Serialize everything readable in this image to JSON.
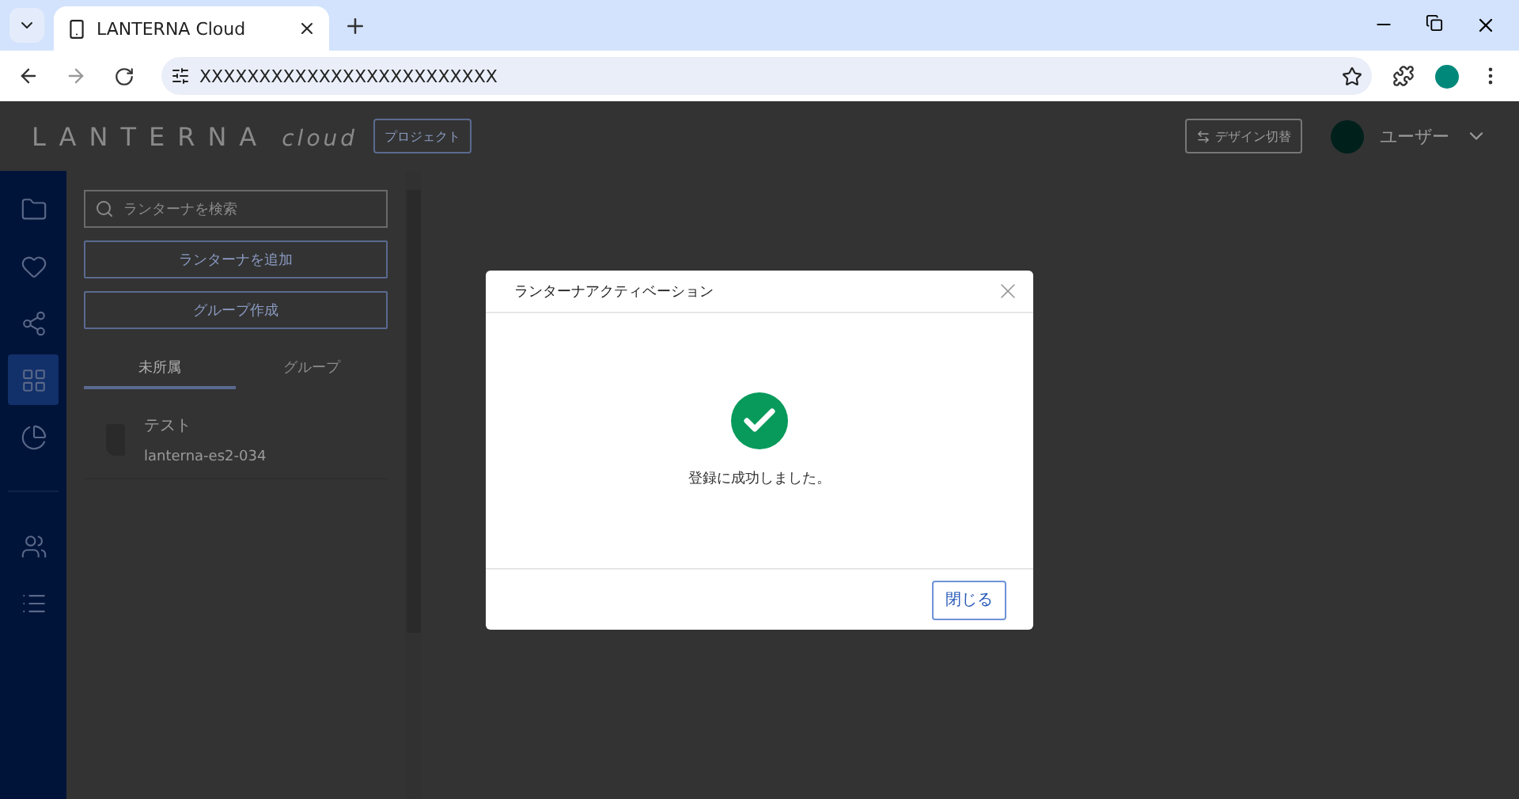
{
  "browser": {
    "tab_title": "LANTERNA Cloud",
    "url": "XXXXXXXXXXXXXXXXXXXXXXXXX"
  },
  "header": {
    "brand": "LANTERNA",
    "brand_suffix": "cloud",
    "project_button": "プロジェクト",
    "design_button": "デザイン切替",
    "user": "ユーザー"
  },
  "nav": [
    {
      "kind": "folder",
      "selected": false
    },
    {
      "kind": "heart",
      "selected": false
    },
    {
      "kind": "share",
      "selected": false
    },
    {
      "kind": "grid",
      "selected": true
    },
    {
      "kind": "chart",
      "selected": false
    }
  ],
  "nav_bottom": [
    {
      "kind": "people",
      "selected": false
    },
    {
      "kind": "list",
      "selected": false
    }
  ],
  "panel": {
    "search": {
      "placeholder": "ランターナを検索"
    },
    "buttons": [
      "ランターナを追加",
      "グループ作成"
    ],
    "tabs": [
      {
        "label": "未所属",
        "selected": true
      },
      {
        "label": "グループ",
        "selected": false
      }
    ],
    "items": [
      {
        "name": "テスト",
        "id": "lanterna-es2-034"
      }
    ]
  },
  "dialog": {
    "title": "ランターナアクティベーション",
    "message": "登録に成功しました。",
    "close_button": "閉じる"
  }
}
